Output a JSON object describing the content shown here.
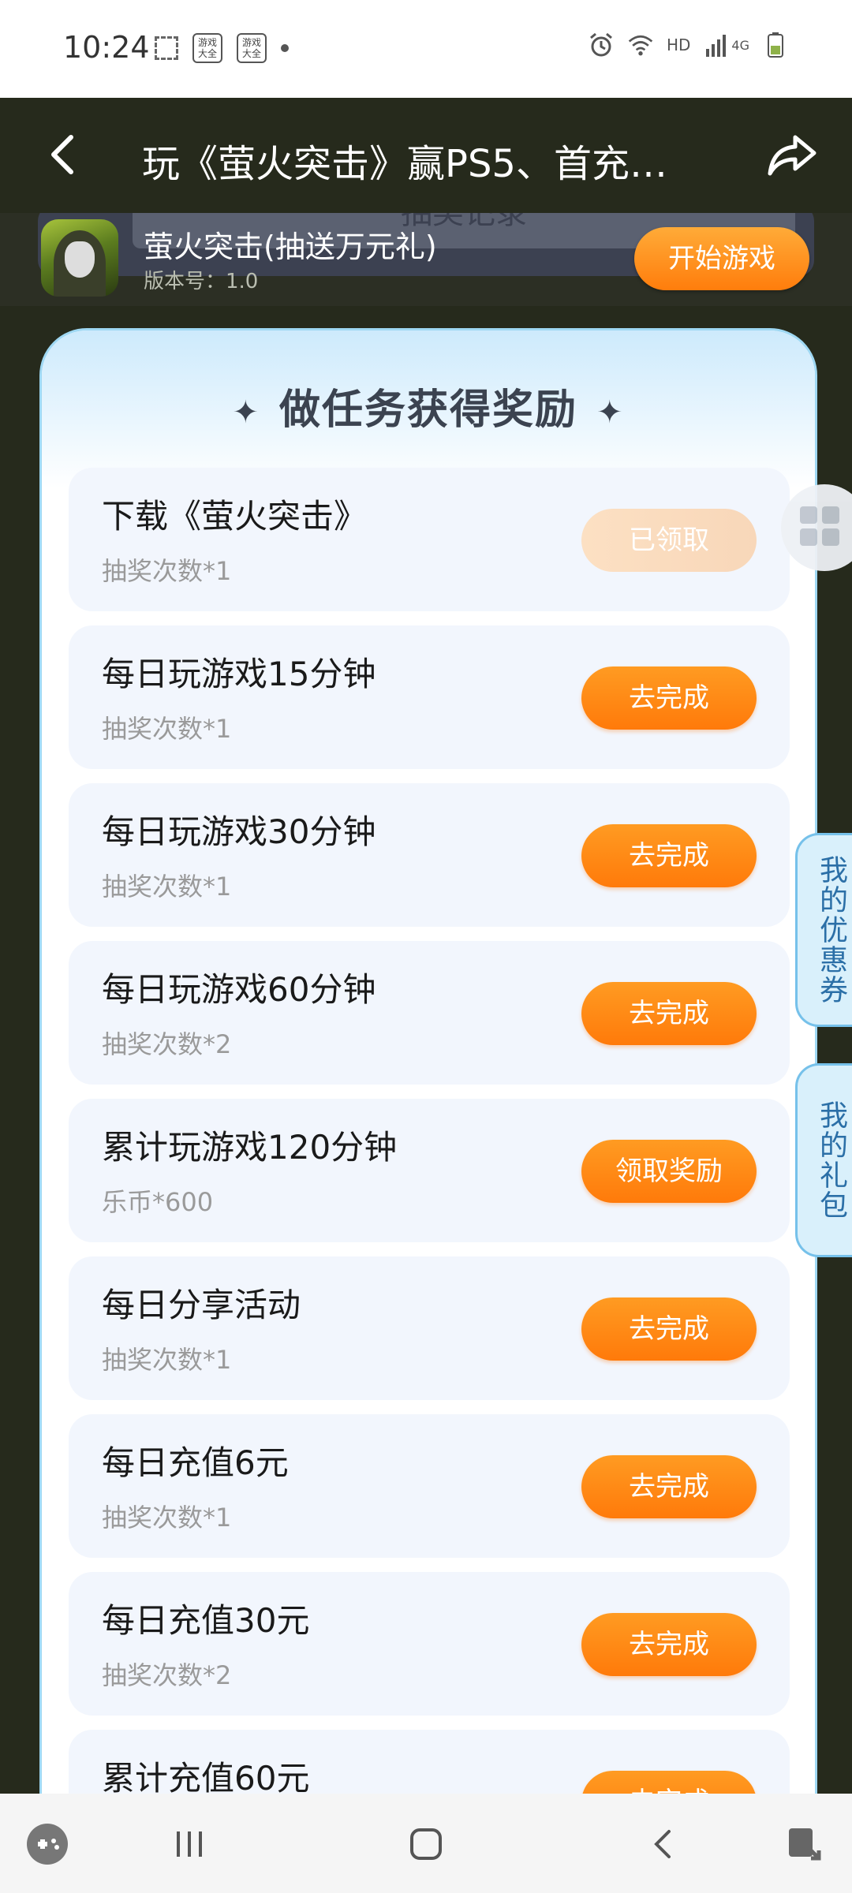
{
  "status_bar": {
    "time": "10:24",
    "app_icon_1": "游戏大全",
    "app_icon_2": "游戏大全",
    "network": "HD",
    "signal_type": "4G"
  },
  "header": {
    "title": "玩《萤火突击》赢PS5、首充…"
  },
  "game_bar": {
    "ghost_text": "抽奖记录",
    "name": "萤火突击(抽送万元礼)",
    "version": "版本号：1.0",
    "start_label": "开始游戏"
  },
  "tasks_section": {
    "title": "做任务获得奖励",
    "star_left": "✦",
    "star_right": "✦"
  },
  "tasks": [
    {
      "title": "下载《萤火突击》",
      "reward": "抽奖次数*1",
      "button": "已领取",
      "done": true
    },
    {
      "title": "每日玩游戏15分钟",
      "reward": "抽奖次数*1",
      "button": "去完成",
      "done": false
    },
    {
      "title": "每日玩游戏30分钟",
      "reward": "抽奖次数*1",
      "button": "去完成",
      "done": false
    },
    {
      "title": "每日玩游戏60分钟",
      "reward": "抽奖次数*2",
      "button": "去完成",
      "done": false
    },
    {
      "title": "累计玩游戏120分钟",
      "reward": "乐币*600",
      "button": "领取奖励",
      "done": false
    },
    {
      "title": "每日分享活动",
      "reward": "抽奖次数*1",
      "button": "去完成",
      "done": false
    },
    {
      "title": "每日充值6元",
      "reward": "抽奖次数*1",
      "button": "去完成",
      "done": false
    },
    {
      "title": "每日充值30元",
      "reward": "抽奖次数*2",
      "button": "去完成",
      "done": false
    },
    {
      "title": "累计充值60元",
      "reward": "",
      "button": "去完成",
      "done": false
    }
  ],
  "side_tabs": {
    "coupons": "我的优惠券",
    "gifts": "我的礼包"
  },
  "colors": {
    "accent_orange": "#ff7d0c",
    "header_bg": "#262a1c",
    "card_border": "#9fd8f3"
  }
}
